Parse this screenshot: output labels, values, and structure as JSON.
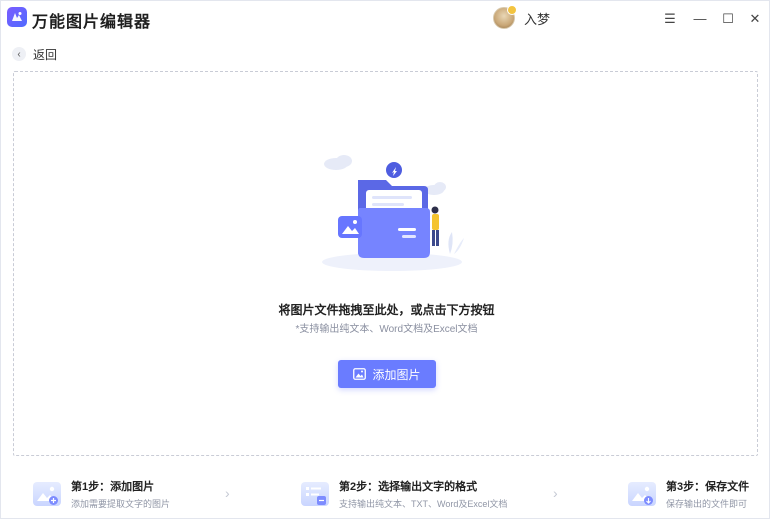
{
  "app": {
    "title": "万能图片编辑器",
    "user_name": "入梦"
  },
  "window_controls": {
    "menu": "☰",
    "minimize": "—",
    "maximize": "☐",
    "close": "✕"
  },
  "nav": {
    "back_label": "返回",
    "back_icon": "‹"
  },
  "dropzone": {
    "title": "将图片文件拖拽至此处，或点击下方按钮",
    "subtitle": "*支持输出纯文本、Word文档及Excel文档",
    "add_button_label": "添加图片"
  },
  "steps": [
    {
      "title": "第1步：添加图片",
      "desc": "添加需要提取文字的图片"
    },
    {
      "title": "第2步：选择输出文字的格式",
      "desc": "支持输出纯文本、TXT、Word及Excel文档"
    },
    {
      "title": "第3步：保存文件",
      "desc": "保存输出的文件即可"
    }
  ],
  "colors": {
    "accent": "#6a7cff",
    "logo": "#6b62ff"
  }
}
